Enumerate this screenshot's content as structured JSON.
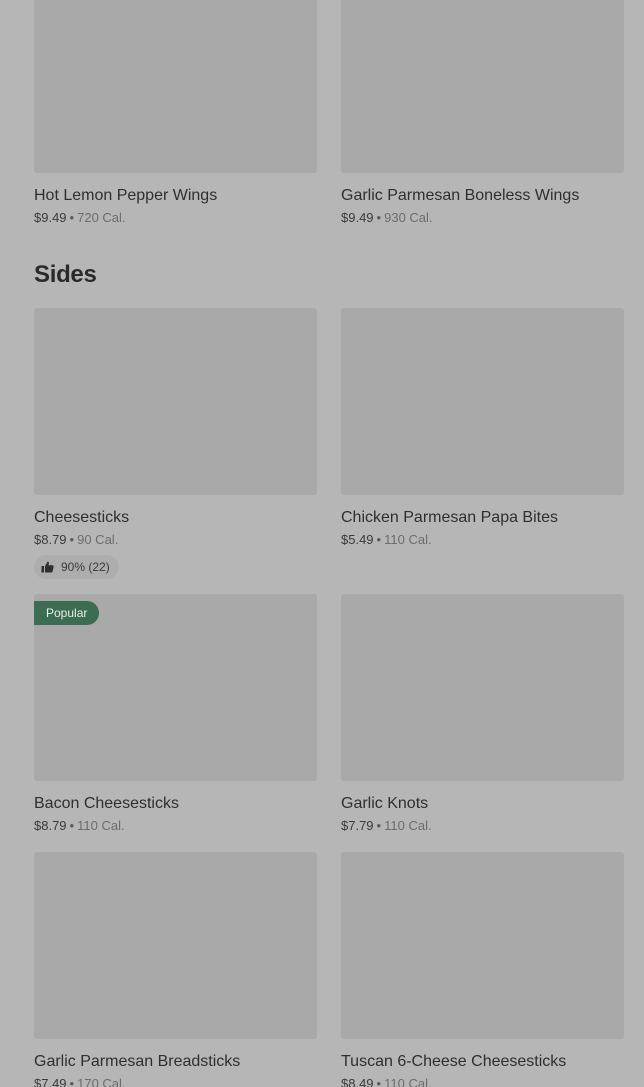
{
  "top_items": [
    {
      "name": "Hot Lemon Pepper Wings",
      "price": "$9.49",
      "calories": "720 Cal."
    },
    {
      "name": "Garlic Parmesan Boneless Wings",
      "price": "$9.49",
      "calories": "930 Cal."
    }
  ],
  "sides": {
    "title": "Sides",
    "items": [
      {
        "name": "Cheesesticks",
        "price": "$8.79",
        "calories": "90 Cal.",
        "rating": "90% (22)"
      },
      {
        "name": "Chicken Parmesan Papa Bites",
        "price": "$5.49",
        "calories": "110 Cal."
      },
      {
        "name": "Bacon Cheesesticks",
        "price": "$8.79",
        "calories": "110 Cal.",
        "badge": "Popular"
      },
      {
        "name": "Garlic Knots",
        "price": "$7.79",
        "calories": "110 Cal."
      },
      {
        "name": "Garlic Parmesan Breadsticks",
        "price": "$7.49",
        "calories": "170 Cal."
      },
      {
        "name": "Tuscan 6-Cheese Cheesesticks",
        "price": "$8.49",
        "calories": "110 Cal."
      }
    ]
  },
  "separator": "•",
  "icons": {
    "rating": "thumbs-up-icon"
  },
  "colors": {
    "badge_bg": "#3c6c51",
    "image_placeholder": "#a9a9a9"
  }
}
